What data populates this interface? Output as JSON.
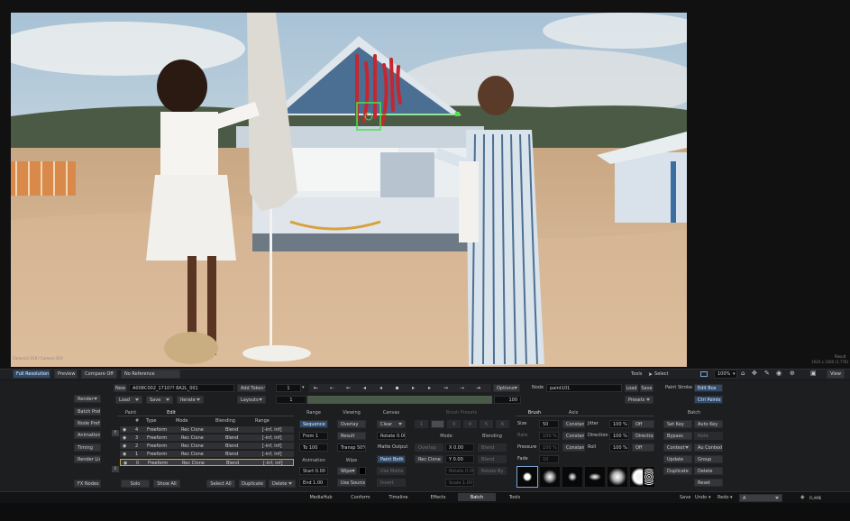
{
  "viewer": {
    "corner_left": "Camera1 019 / Camera 019",
    "corner_right": "Result",
    "corner_right_sub": "1920 x 1080 (1.778)"
  },
  "topbar": {
    "full_resolution": "Full Resolution",
    "preview": "Preview",
    "compare_off": "Compare Off",
    "no_reference": "No Reference",
    "tools_label": "Tools",
    "select": "Select",
    "zoom": "100%",
    "view": "View"
  },
  "left_col": {
    "render": "Render",
    "batch_prefs": "Batch Prefs",
    "node_prefs": "Node Prefs",
    "animation": "Animation",
    "timing": "Timing",
    "render_list": "Render List",
    "fx_nodes": "FX Nodes"
  },
  "row1": {
    "new": "New",
    "clip_name": "A008C002_1710?? 8A2L_001",
    "add_token": "Add Token",
    "frame": "1",
    "node_label": "Node",
    "node_name": "paint101",
    "load": "Load",
    "save": "Save",
    "paint_stroke": "Paint Stroke",
    "edit_box": "Edit Box"
  },
  "row2": {
    "load": "Load",
    "save": "Save",
    "iterate": "Iterate",
    "layouts": "Layouts",
    "frame_field": "1",
    "end_frame": "100",
    "presets": "Presets",
    "ctrl_points": "Ctrl Points"
  },
  "tabs_edit": {
    "paint": "Paint",
    "edit": "Edit"
  },
  "table": {
    "headers": [
      "#",
      "Type",
      "Mode",
      "Blending",
      "Range"
    ],
    "rows": [
      {
        "num": "4",
        "type": "Freeform",
        "mode": "Rec Clone",
        "blend": "Blend",
        "range": "[-inf, inf]"
      },
      {
        "num": "3",
        "type": "Freeform",
        "mode": "Rec Clone",
        "blend": "Blend",
        "range": "[-inf, inf]"
      },
      {
        "num": "2",
        "type": "Freeform",
        "mode": "Rec Clone",
        "blend": "Blend",
        "range": "[-inf, inf]"
      },
      {
        "num": "1",
        "type": "Freeform",
        "mode": "Rec Clone",
        "blend": "Blend",
        "range": "[-inf, inf]"
      },
      {
        "num": "0",
        "type": "Freeform",
        "mode": "Rec Clone",
        "blend": "Blend",
        "range": "[-inf, inf]"
      }
    ],
    "solo": "Solo",
    "show_all": "Show All",
    "select_all": "Select All",
    "duplicate": "Duplicate",
    "delete": "Delete"
  },
  "range": {
    "header": "Range",
    "sequence": "Sequence",
    "from": "From 1",
    "to": "To 100",
    "animation_header": "Animation",
    "start": "Start 0.00",
    "end": "End 1.00"
  },
  "viewing": {
    "header": "Viewing",
    "overlay": "Overlay",
    "result": "Result",
    "transp": "Transp 50%",
    "wipe_header": "Wipe",
    "wipe": "Wipe",
    "use_source": "Use Source"
  },
  "canvas": {
    "header": "Canvas",
    "clear": "Clear",
    "rotate": "Rotate 0.00",
    "matte_output": "Matte Output",
    "paint_both": "Paint Both",
    "use_matte": "Use Matte",
    "invert": "Invert"
  },
  "brush_presets": {
    "header": "Brush Presets",
    "slots": [
      "1",
      "2",
      "3",
      "4",
      "5",
      "6"
    ],
    "mode_header": "Mode",
    "blending_header": "Blending",
    "mode": "Overlap",
    "blend": "Blend",
    "x_val": "X 0.00",
    "y_val": "Y 0.00",
    "rec_clone": "Rec Clone",
    "rotate": "Rotate 0.00",
    "rotate_by": "Rotate By",
    "scale": "Scale 1.00"
  },
  "brush": {
    "tab_brush": "Brush",
    "tab_axis": "Axis",
    "size_label": "Size",
    "size": "50",
    "constant": "Constant",
    "jitter_label": "Jitter",
    "jitter": "100 %",
    "off": "Off",
    "rate_label": "Rate",
    "rate": "100 %",
    "direction_label": "Direction",
    "direction": "100 %",
    "direction_btn": "Direction",
    "pressure_label": "Pressure",
    "pressure": "100 %",
    "roll_label": "Roll",
    "roll": "100 %",
    "fade_label": "Fade",
    "fade": "10"
  },
  "batch": {
    "header": "Batch",
    "set_key": "Set Key",
    "auto_key": "Auto Key",
    "bypass": "Bypass",
    "note": "Note",
    "context": "Context",
    "au_context": "Au Context",
    "update": "Update",
    "group": "Group",
    "duplicate": "Duplicate",
    "delete": "Delete",
    "reset": "Reset"
  },
  "bottom_tabs": [
    "MediaHub",
    "Conform",
    "Timeline",
    "Effects",
    "Batch",
    "Tools"
  ],
  "bottom_right": {
    "save": "Save",
    "undo": "Undo",
    "redo": "Redo",
    "field": "A",
    "brand": "FLAME"
  },
  "colors": {
    "panel": "#1d1e20",
    "button": "#34363a",
    "accent_blue": "#2f4a6b",
    "timeline_green": "#4a5a48",
    "paint_red": "#c62630",
    "selection_green": "#49e34b"
  }
}
